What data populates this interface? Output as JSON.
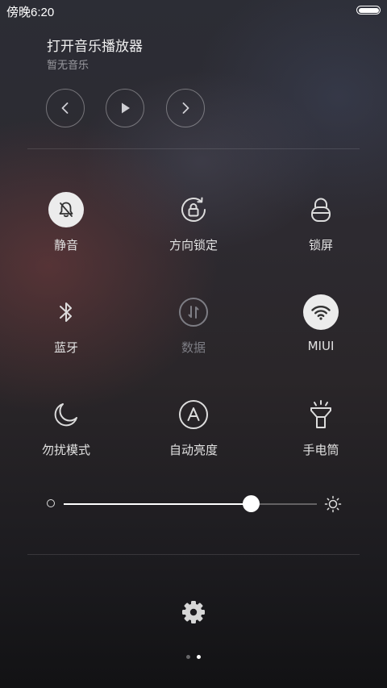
{
  "status_bar": {
    "time": "傍晚6:20",
    "battery_icon": "battery-icon",
    "battery_level": 1.0
  },
  "music": {
    "title": "打开音乐播放器",
    "subtitle": "暂无音乐",
    "controls": [
      "previous-icon",
      "play-icon",
      "next-icon"
    ]
  },
  "toggles": [
    {
      "label": "静音",
      "icon": "bell-off-icon",
      "active": true
    },
    {
      "label": "方向锁定",
      "icon": "rotation-lock-icon",
      "active": false
    },
    {
      "label": "锁屏",
      "icon": "lock-icon",
      "active": false
    },
    {
      "label": "蓝牙",
      "icon": "bluetooth-icon",
      "active": false
    },
    {
      "label": "数据",
      "icon": "mobile-data-icon",
      "active": false,
      "disabled": true
    },
    {
      "label": "MIUI",
      "icon": "wifi-icon",
      "active": true
    },
    {
      "label": "勿扰模式",
      "icon": "moon-icon",
      "active": false
    },
    {
      "label": "自动亮度",
      "icon": "auto-brightness-icon",
      "active": false
    },
    {
      "label": "手电筒",
      "icon": "flashlight-icon",
      "active": false
    }
  ],
  "brightness": {
    "level": 0.74,
    "low_icon": "brightness-low-icon",
    "high_icon": "brightness-high-icon"
  },
  "settings_icon": "gear-icon",
  "pager": {
    "count": 2,
    "current": 1
  },
  "colors": {
    "active_bg": "#ececec",
    "active_fg": "#333333",
    "icon": "#dcdcdc"
  }
}
